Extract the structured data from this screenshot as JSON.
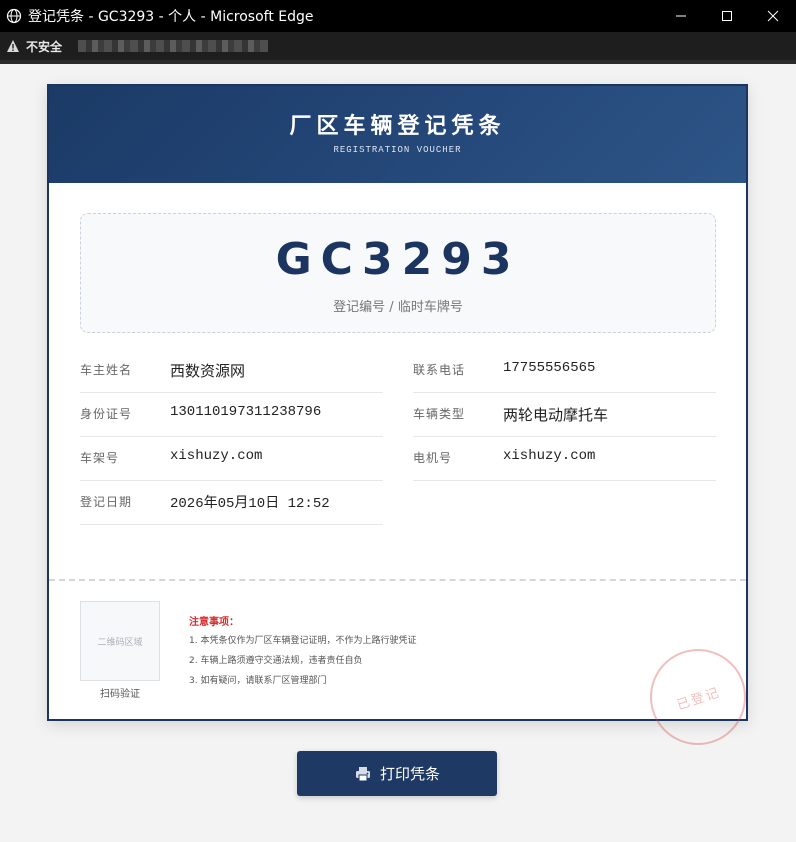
{
  "window": {
    "title": "登记凭条 - GC3293 - 个人 - Microsoft Edge",
    "address_warning": "不安全"
  },
  "voucher": {
    "title": "厂区车辆登记凭条",
    "subtitle": "REGISTRATION VOUCHER",
    "plate_number": "GC3293",
    "plate_label": "登记编号 / 临时车牌号",
    "fields_left": [
      {
        "label": "车主姓名",
        "value": "西数资源网"
      },
      {
        "label": "身份证号",
        "value": "130110197311238796"
      },
      {
        "label": "车架号",
        "value": "xishuzy.com"
      },
      {
        "label": "登记日期",
        "value": "2026年05月10日 12:52"
      }
    ],
    "fields_right": [
      {
        "label": "联系电话",
        "value": "17755556565"
      },
      {
        "label": "车辆类型",
        "value": "两轮电动摩托车"
      },
      {
        "label": "电机号",
        "value": "xishuzy.com"
      }
    ],
    "qr_placeholder": "二维码区域",
    "qr_caption": "扫码验证",
    "notes_title": "注意事项：",
    "notes": [
      "1. 本凭条仅作为厂区车辆登记证明，不作为上路行驶凭证",
      "2. 车辆上路须遵守交通法规，违者责任自负",
      "3. 如有疑问，请联系厂区管理部门"
    ],
    "stamp_text": "已登记"
  },
  "actions": {
    "print_label": "打印凭条"
  },
  "colors": {
    "header": "#1b3a66",
    "accent": "#1e3a64",
    "notes_title": "#d32f2f"
  }
}
